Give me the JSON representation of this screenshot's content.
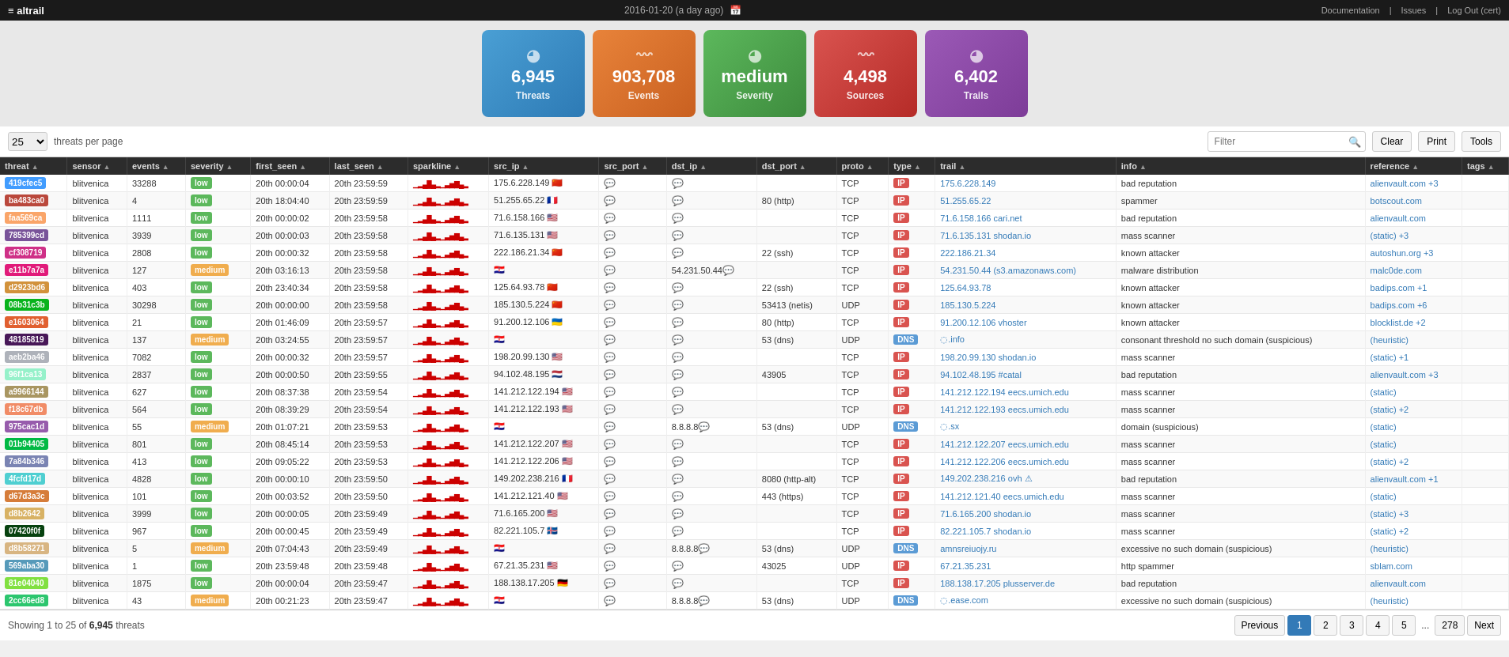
{
  "app": {
    "logo": "≡ altrail",
    "date": "2016-01-20 (a day ago)",
    "nav": [
      "Documentation",
      "Issues",
      "Log Out (cert)"
    ]
  },
  "stats": [
    {
      "id": "threats",
      "number": "6,945",
      "label": "Threats",
      "color": "blue"
    },
    {
      "id": "events",
      "number": "903,708",
      "label": "Events",
      "color": "orange"
    },
    {
      "id": "severity",
      "number": "medium",
      "label": "Severity",
      "color": "green"
    },
    {
      "id": "sources",
      "number": "4,498",
      "label": "Sources",
      "color": "red"
    },
    {
      "id": "trails",
      "number": "6,402",
      "label": "Trails",
      "color": "purple"
    }
  ],
  "toolbar": {
    "per_page": "25",
    "per_page_label": "threats per page",
    "filter_placeholder": "Filter",
    "clear_label": "Clear",
    "print_label": "Print",
    "tools_label": "Tools"
  },
  "table": {
    "columns": [
      "threat",
      "sensor",
      "events",
      "severity",
      "first_seen",
      "last_seen",
      "sparkline",
      "src_ip",
      "src_port",
      "dst_ip",
      "dst_port",
      "proto",
      "type",
      "trail",
      "info",
      "reference",
      "tags"
    ],
    "rows": [
      {
        "threat": "419cfec5",
        "sensor": "blitvenica",
        "events": "33288",
        "severity": "low",
        "first_seen": "20th 00:00:04",
        "last_seen": "20th 23:59:59",
        "src_ip": "175.6.228.149",
        "src_ip_flag": "🇨🇳",
        "src_port": "",
        "dst_ip": "",
        "dst_port": "",
        "proto": "TCP",
        "type": "IP",
        "trail": "175.6.228.149",
        "info": "bad reputation",
        "reference": "alienvault.com +3",
        "tags": ""
      },
      {
        "threat": "ba483ca0",
        "sensor": "blitvenica",
        "events": "4",
        "severity": "low",
        "first_seen": "20th 18:04:40",
        "last_seen": "20th 23:59:59",
        "src_ip": "51.255.65.22",
        "src_ip_flag": "🇫🇷",
        "src_port": "",
        "dst_ip": "",
        "dst_port": "80 (http)",
        "proto": "TCP",
        "type": "IP",
        "trail": "51.255.65.22",
        "info": "spammer",
        "reference": "botscout.com",
        "tags": ""
      },
      {
        "threat": "faa569ca",
        "sensor": "blitvenica",
        "events": "1111",
        "severity": "low",
        "first_seen": "20th 00:00:02",
        "last_seen": "20th 23:59:58",
        "src_ip": "71.6.158.166",
        "src_ip_flag": "🇺🇸",
        "src_port": "",
        "dst_ip": "",
        "dst_port": "",
        "proto": "TCP",
        "type": "IP",
        "trail": "71.6.158.166 cari.net",
        "info": "bad reputation",
        "reference": "alienvault.com",
        "tags": ""
      },
      {
        "threat": "785399cd",
        "sensor": "blitvenica",
        "events": "3939",
        "severity": "low",
        "first_seen": "20th 00:00:03",
        "last_seen": "20th 23:59:58",
        "src_ip": "71.6.135.131",
        "src_ip_flag": "🇺🇸",
        "src_port": "",
        "dst_ip": "",
        "dst_port": "",
        "proto": "TCP",
        "type": "IP",
        "trail": "71.6.135.131 shodan.io",
        "info": "mass scanner",
        "reference": "(static) +3",
        "tags": ""
      },
      {
        "threat": "cf308719",
        "sensor": "blitvenica",
        "events": "2808",
        "severity": "low",
        "first_seen": "20th 00:00:32",
        "last_seen": "20th 23:59:58",
        "src_ip": "222.186.21.34",
        "src_ip_flag": "🇨🇳",
        "src_port": "",
        "dst_ip": "",
        "dst_port": "22 (ssh)",
        "proto": "TCP",
        "type": "IP",
        "trail": "222.186.21.34",
        "info": "known attacker",
        "reference": "autoshun.org +3",
        "tags": ""
      },
      {
        "threat": "e11b7a7a",
        "sensor": "blitvenica",
        "events": "127",
        "severity": "medium",
        "first_seen": "20th 03:16:13",
        "last_seen": "20th 23:59:58",
        "src_ip": "",
        "src_ip_flag": "🇭🇷",
        "src_port": "",
        "dst_ip": "54.231.50.44",
        "dst_port": "",
        "proto": "TCP",
        "type": "IP",
        "trail": "54.231.50.44 (s3.amazonaws.com)",
        "info": "malware distribution",
        "reference": "malc0de.com",
        "tags": ""
      },
      {
        "threat": "d2923bd6",
        "sensor": "blitvenica",
        "events": "403",
        "severity": "low",
        "first_seen": "20th 23:40:34",
        "last_seen": "20th 23:59:58",
        "src_ip": "125.64.93.78",
        "src_ip_flag": "🇨🇳",
        "src_port": "",
        "dst_ip": "",
        "dst_port": "22 (ssh)",
        "proto": "TCP",
        "type": "IP",
        "trail": "125.64.93.78",
        "info": "known attacker",
        "reference": "badips.com +1",
        "tags": ""
      },
      {
        "threat": "08b31c3b",
        "sensor": "blitvenica",
        "events": "30298",
        "severity": "low",
        "first_seen": "20th 00:00:00",
        "last_seen": "20th 23:59:58",
        "src_ip": "185.130.5.224",
        "src_ip_flag": "🇨🇳",
        "src_port": "",
        "dst_ip": "",
        "dst_port": "53413 (netis)",
        "proto": "UDP",
        "type": "IP",
        "trail": "185.130.5.224",
        "info": "known attacker",
        "reference": "badips.com +6",
        "tags": ""
      },
      {
        "threat": "e1603064",
        "sensor": "blitvenica",
        "events": "21",
        "severity": "low",
        "first_seen": "20th 01:46:09",
        "last_seen": "20th 23:59:57",
        "src_ip": "91.200.12.106",
        "src_ip_flag": "🇺🇦",
        "src_port": "",
        "dst_ip": "",
        "dst_port": "80 (http)",
        "proto": "TCP",
        "type": "IP",
        "trail": "91.200.12.106 vhoster",
        "info": "known attacker",
        "reference": "blocklist.de +2",
        "tags": ""
      },
      {
        "threat": "48185819",
        "sensor": "blitvenica",
        "events": "137",
        "severity": "medium",
        "first_seen": "20th 03:24:55",
        "last_seen": "20th 23:59:57",
        "src_ip": "",
        "src_ip_flag": "🇭🇷",
        "src_port": "",
        "dst_ip": "",
        "dst_port": "53 (dns)",
        "proto": "UDP",
        "type": "DNS",
        "trail": "◌.info",
        "info": "consonant threshold no such domain (suspicious)",
        "reference": "(heuristic)",
        "tags": ""
      },
      {
        "threat": "aeb2ba46",
        "sensor": "blitvenica",
        "events": "7082",
        "severity": "low",
        "first_seen": "20th 00:00:32",
        "last_seen": "20th 23:59:57",
        "src_ip": "198.20.99.130",
        "src_ip_flag": "🇺🇸",
        "src_port": "",
        "dst_ip": "",
        "dst_port": "",
        "proto": "TCP",
        "type": "IP",
        "trail": "198.20.99.130 shodan.io",
        "info": "mass scanner",
        "reference": "(static) +1",
        "tags": ""
      },
      {
        "threat": "96f1ca13",
        "sensor": "blitvenica",
        "events": "2837",
        "severity": "low",
        "first_seen": "20th 00:00:50",
        "last_seen": "20th 23:59:55",
        "src_ip": "94.102.48.195",
        "src_ip_flag": "🇳🇱",
        "src_port": "",
        "dst_ip": "",
        "dst_port": "43905",
        "proto": "TCP",
        "type": "IP",
        "trail": "94.102.48.195 #catal",
        "info": "bad reputation",
        "reference": "alienvault.com +3",
        "tags": ""
      },
      {
        "threat": "a9966144",
        "sensor": "blitvenica",
        "events": "627",
        "severity": "low",
        "first_seen": "20th 08:37:38",
        "last_seen": "20th 23:59:54",
        "src_ip": "141.212.122.194",
        "src_ip_flag": "🇺🇸",
        "src_port": "",
        "dst_ip": "",
        "dst_port": "",
        "proto": "TCP",
        "type": "IP",
        "trail": "141.212.122.194 eecs.umich.edu",
        "info": "mass scanner",
        "reference": "(static)",
        "tags": ""
      },
      {
        "threat": "f18c67db",
        "sensor": "blitvenica",
        "events": "564",
        "severity": "low",
        "first_seen": "20th 08:39:29",
        "last_seen": "20th 23:59:54",
        "src_ip": "141.212.122.193",
        "src_ip_flag": "🇺🇸",
        "src_port": "",
        "dst_ip": "",
        "dst_port": "",
        "proto": "TCP",
        "type": "IP",
        "trail": "141.212.122.193 eecs.umich.edu",
        "info": "mass scanner",
        "reference": "(static) +2",
        "tags": ""
      },
      {
        "threat": "975cac1d",
        "sensor": "blitvenica",
        "events": "55",
        "severity": "medium",
        "first_seen": "20th 01:07:21",
        "last_seen": "20th 23:59:53",
        "src_ip": "",
        "src_ip_flag": "🇭🇷",
        "src_port": "",
        "dst_ip": "8.8.8.8",
        "dst_port": "53 (dns)",
        "proto": "UDP",
        "type": "DNS",
        "trail": "◌.sx",
        "info": "domain (suspicious)",
        "reference": "(static)",
        "tags": ""
      },
      {
        "threat": "01b94405",
        "sensor": "blitvenica",
        "events": "801",
        "severity": "low",
        "first_seen": "20th 08:45:14",
        "last_seen": "20th 23:59:53",
        "src_ip": "141.212.122.207",
        "src_ip_flag": "🇺🇸",
        "src_port": "",
        "dst_ip": "",
        "dst_port": "",
        "proto": "TCP",
        "type": "IP",
        "trail": "141.212.122.207 eecs.umich.edu",
        "info": "mass scanner",
        "reference": "(static)",
        "tags": ""
      },
      {
        "threat": "7a84b346",
        "sensor": "blitvenica",
        "events": "413",
        "severity": "low",
        "first_seen": "20th 09:05:22",
        "last_seen": "20th 23:59:53",
        "src_ip": "141.212.122.206",
        "src_ip_flag": "🇺🇸",
        "src_port": "",
        "dst_ip": "",
        "dst_port": "",
        "proto": "TCP",
        "type": "IP",
        "trail": "141.212.122.206 eecs.umich.edu",
        "info": "mass scanner",
        "reference": "(static) +2",
        "tags": ""
      },
      {
        "threat": "4fcfd17d",
        "sensor": "blitvenica",
        "events": "4828",
        "severity": "low",
        "first_seen": "20th 00:00:10",
        "last_seen": "20th 23:59:50",
        "src_ip": "149.202.238.216",
        "src_ip_flag": "🇫🇷",
        "src_port": "",
        "dst_ip": "",
        "dst_port": "8080 (http-alt)",
        "proto": "TCP",
        "type": "IP",
        "trail": "149.202.238.216 ovh ⚠",
        "info": "bad reputation",
        "reference": "alienvault.com +1",
        "tags": ""
      },
      {
        "threat": "d67d3a3c",
        "sensor": "blitvenica",
        "events": "101",
        "severity": "low",
        "first_seen": "20th 00:03:52",
        "last_seen": "20th 23:59:50",
        "src_ip": "141.212.121.40",
        "src_ip_flag": "🇺🇸",
        "src_port": "",
        "dst_ip": "",
        "dst_port": "443 (https)",
        "proto": "TCP",
        "type": "IP",
        "trail": "141.212.121.40 eecs.umich.edu",
        "info": "mass scanner",
        "reference": "(static)",
        "tags": ""
      },
      {
        "threat": "d8b2642",
        "sensor": "blitvenica",
        "events": "3999",
        "severity": "low",
        "first_seen": "20th 00:00:05",
        "last_seen": "20th 23:59:49",
        "src_ip": "71.6.165.200",
        "src_ip_flag": "🇺🇸",
        "src_port": "",
        "dst_ip": "",
        "dst_port": "",
        "proto": "TCP",
        "type": "IP",
        "trail": "71.6.165.200 shodan.io",
        "info": "mass scanner",
        "reference": "(static) +3",
        "tags": ""
      },
      {
        "threat": "07420f0f",
        "sensor": "blitvenica",
        "events": "967",
        "severity": "low",
        "first_seen": "20th 00:00:45",
        "last_seen": "20th 23:59:49",
        "src_ip": "82.221.105.7",
        "src_ip_flag": "🇮🇸",
        "src_port": "",
        "dst_ip": "",
        "dst_port": "",
        "proto": "TCP",
        "type": "IP",
        "trail": "82.221.105.7 shodan.io",
        "info": "mass scanner",
        "reference": "(static) +2",
        "tags": ""
      },
      {
        "threat": "d8b58271",
        "sensor": "blitvenica",
        "events": "5",
        "severity": "medium",
        "first_seen": "20th 07:04:43",
        "last_seen": "20th 23:59:49",
        "src_ip": "",
        "src_ip_flag": "🇭🇷",
        "src_port": "",
        "dst_ip": "8.8.8.8",
        "dst_port": "53 (dns)",
        "proto": "UDP",
        "type": "DNS",
        "trail": "amnsreiuojy.ru",
        "info": "excessive no such domain (suspicious)",
        "reference": "(heuristic)",
        "tags": ""
      },
      {
        "threat": "569aba30",
        "sensor": "blitvenica",
        "events": "1",
        "severity": "low",
        "first_seen": "20th 23:59:48",
        "last_seen": "20th 23:59:48",
        "src_ip": "67.21.35.231",
        "src_ip_flag": "🇺🇸",
        "src_port": "",
        "dst_ip": "",
        "dst_port": "43025",
        "proto": "UDP",
        "type": "IP",
        "trail": "67.21.35.231",
        "info": "http spammer",
        "reference": "sblam.com",
        "tags": ""
      },
      {
        "threat": "81e04040",
        "sensor": "blitvenica",
        "events": "1875",
        "severity": "low",
        "first_seen": "20th 00:00:04",
        "last_seen": "20th 23:59:47",
        "src_ip": "188.138.17.205",
        "src_ip_flag": "🇩🇪",
        "src_port": "",
        "dst_ip": "",
        "dst_port": "",
        "proto": "TCP",
        "type": "IP",
        "trail": "188.138.17.205 plusserver.de",
        "info": "bad reputation",
        "reference": "alienvault.com",
        "tags": ""
      },
      {
        "threat": "2cc66ed8",
        "sensor": "blitvenica",
        "events": "43",
        "severity": "medium",
        "first_seen": "20th 00:21:23",
        "last_seen": "20th 23:59:47",
        "src_ip": "",
        "src_ip_flag": "🇭🇷",
        "src_port": "",
        "dst_ip": "8.8.8.8",
        "dst_port": "53 (dns)",
        "proto": "UDP",
        "type": "DNS",
        "trail": "◌.ease.com",
        "info": "excessive no such domain (suspicious)",
        "reference": "(heuristic)",
        "tags": ""
      }
    ]
  },
  "footer": {
    "showing": "Showing 1 to 25 of",
    "total": "6,945",
    "unit": "threats",
    "prev_label": "Previous",
    "next_label": "Next",
    "pages": [
      "1",
      "2",
      "3",
      "4",
      "5",
      "...",
      "278"
    ]
  }
}
